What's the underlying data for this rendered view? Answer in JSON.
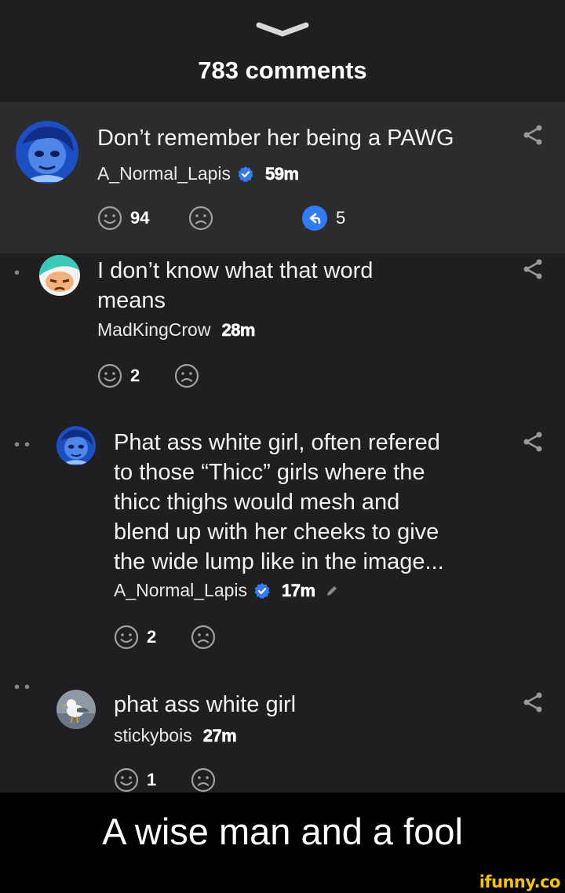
{
  "header": {
    "title": "783 comments"
  },
  "comments": [
    {
      "text": "Don’t remember her being a PAWG",
      "author": "A_Normal_Lapis",
      "verified": true,
      "time": "59m",
      "upvotes": "94",
      "replies": "5"
    },
    {
      "text_line1": "I don’t know what that word",
      "text_line2": "means",
      "author": "MadKingCrow",
      "time": "28m",
      "upvotes": "2"
    },
    {
      "text_line1": "Phat ass white girl, often refered",
      "text_line2": "to those “Thicc” girls where the",
      "text_line3": "thicc thighs would mesh and",
      "text_line4": "blend up with her cheeks to give",
      "text_line5": "the wide lump like in the image...",
      "author": "A_Normal_Lapis",
      "verified": true,
      "time": "17m",
      "upvotes": "2"
    },
    {
      "text": "phat ass white girl",
      "author": "stickybois",
      "time": "27m",
      "upvotes": "1"
    }
  ],
  "caption": "A wise man and a fool",
  "watermark": "ifunny.co",
  "colors": {
    "verified": "#2f7cf6",
    "reply_badge": "#2f7cf6",
    "watermark": "#f5c400",
    "lapis_blue": "#1d4fc4"
  }
}
